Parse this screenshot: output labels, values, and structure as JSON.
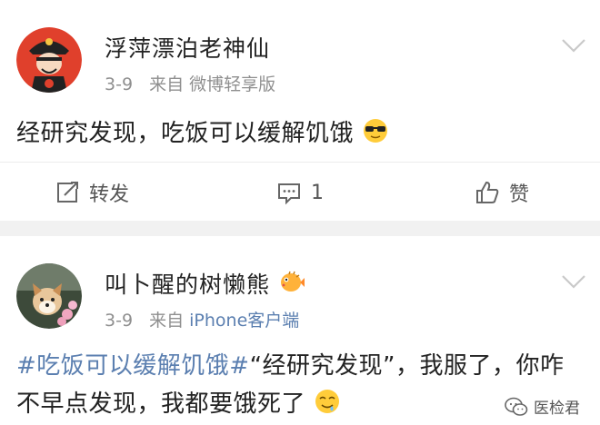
{
  "posts": [
    {
      "username": "浮萍漂泊老神仙",
      "date": "3-9",
      "source_prefix": "来自",
      "source_app": "微博轻享版",
      "content": "经研究发现，吃饭可以缓解饥饿",
      "content_emoji": "sunglasses-emoji",
      "actions": {
        "repost_label": "转发",
        "comment_count": "1",
        "like_label": "赞"
      }
    },
    {
      "username": "叫卜醒的树懒熊",
      "username_emoji": "pufferfish-emoji",
      "date": "3-9",
      "source_prefix": "来自",
      "source_app": "iPhone客户端",
      "hashtag": "#吃饭可以缓解饥饿#",
      "content": "“经研究发现”，我服了，你咋不早点发现，我都要饿死了",
      "content_emoji": "drooling-emoji"
    }
  ],
  "watermark": {
    "label": "医检君",
    "icon": "wechat-icon"
  },
  "colors": {
    "link_blue": "#5b7fb0",
    "meta_gray": "#8f8f8f",
    "divider_gray": "#f1f1f1"
  }
}
